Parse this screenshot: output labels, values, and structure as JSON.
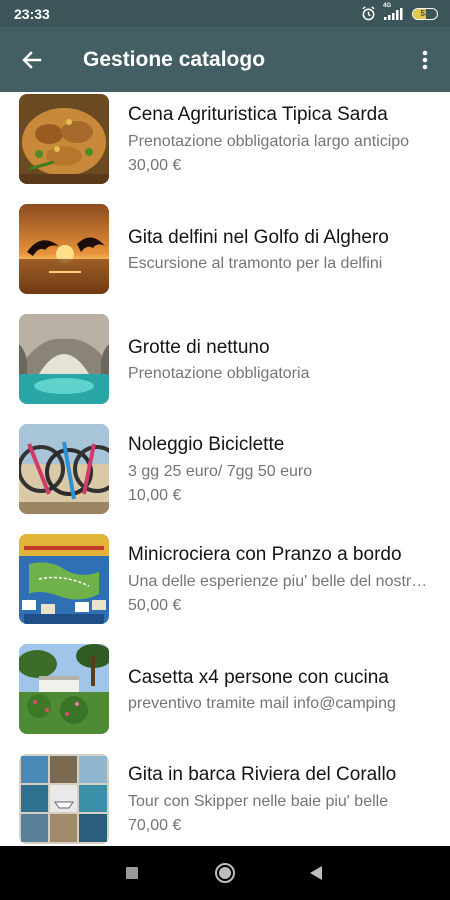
{
  "status_bar": {
    "time": "23:33",
    "network": "4G",
    "battery": "53",
    "battery_level": 0.53
  },
  "app_bar": {
    "title": "Gestione catalogo",
    "back_icon": "arrow-back-icon",
    "menu_icon": "more-vert-icon"
  },
  "items": [
    {
      "title": "Cena Agrituristica Tipica Sarda",
      "description": "Prenotazione obbligatoria largo anticipo",
      "price": "30,00 €",
      "image": "food-dish-photo"
    },
    {
      "title": "Gita delfini nel Golfo di Alghero",
      "description": "Escursione al tramonto per la delfini",
      "price": "",
      "image": "sunset-dolphins-photo"
    },
    {
      "title": "Grotte di nettuno",
      "description": "Prenotazione obbligatoria",
      "price": "",
      "image": "sea-cave-photo"
    },
    {
      "title": "Noleggio Biciclette",
      "description": "3 gg 25 euro/ 7gg 50 euro",
      "price": "10,00 €",
      "image": "bicycles-photo"
    },
    {
      "title": "Minicrociera con Pranzo a bordo",
      "description": "Una delle esperienze piu' belle del nostro mare",
      "price": "50,00 €",
      "image": "cruise-map-photo"
    },
    {
      "title": "Casetta x4 persone con cucina",
      "description": "preventivo tramite mail info@camping",
      "price": "",
      "image": "camping-house-photo"
    },
    {
      "title": "Gita in barca Riviera del Corallo",
      "description": "Tour con Skipper nelle baie piu' belle",
      "price": "70,00 €",
      "image": "boat-collage-photo"
    }
  ],
  "nav_bar": {
    "recents_icon": "recents-square-icon",
    "home_icon": "home-circle-icon",
    "back_icon": "back-triangle-icon"
  }
}
